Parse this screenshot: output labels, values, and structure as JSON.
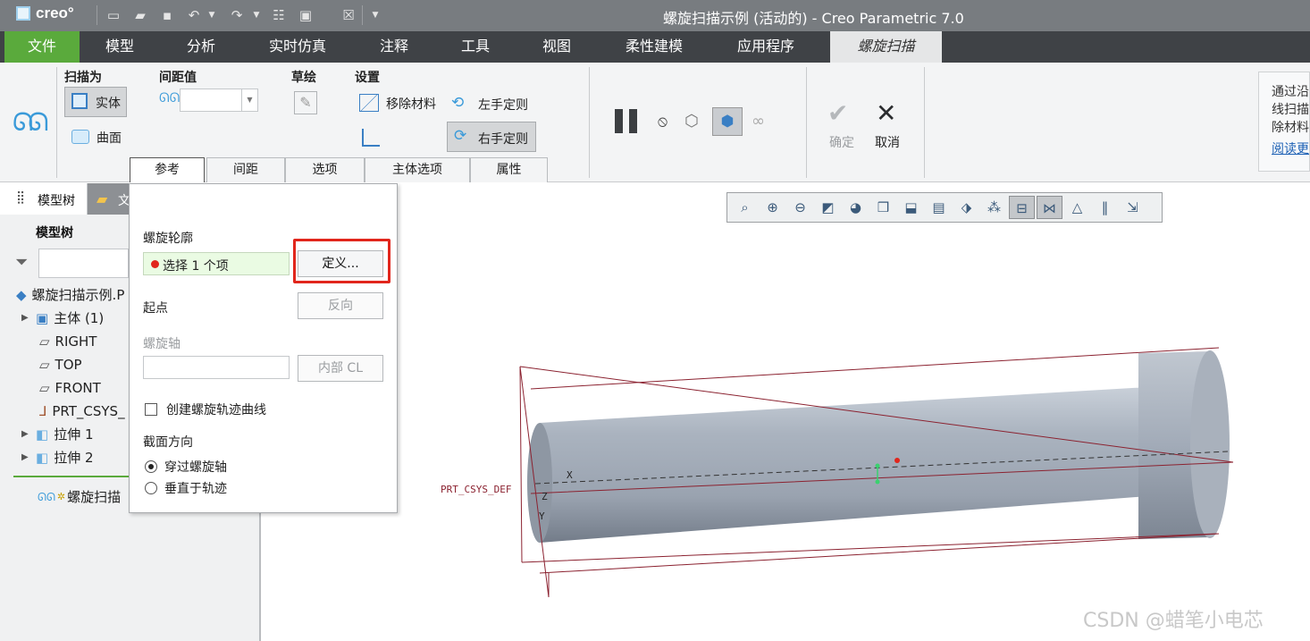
{
  "app": {
    "logo": "creo°",
    "window_title": "螺旋扫描示例 (活动的) - Creo Parametric 7.0"
  },
  "quick_access": [
    "new-icon",
    "open-icon",
    "save-icon",
    "undo-icon",
    "redo-icon",
    "regenerate-icon",
    "windows-icon",
    "close-window-icon",
    "customize-icon"
  ],
  "menu_tabs": [
    "文件",
    "模型",
    "分析",
    "实时仿真",
    "注释",
    "工具",
    "视图",
    "柔性建模",
    "应用程序",
    "螺旋扫描"
  ],
  "ribbon": {
    "sweep_as": {
      "title": "扫描为",
      "solid": "实体",
      "surface": "曲面"
    },
    "pitch": {
      "title": "间距值",
      "value": ""
    },
    "sketch": {
      "title": "草绘"
    },
    "settings": {
      "title": "设置",
      "remove_material": "移除材料",
      "left_hand": "左手定则",
      "right_hand": "右手定则"
    },
    "ok": "确定",
    "cancel": "取消",
    "help_lines": [
      "通过沿",
      "线扫描",
      "除材料"
    ],
    "help_link": "阅读更"
  },
  "sub_tabs": [
    "参考",
    "间距",
    "选项",
    "主体选项",
    "属性"
  ],
  "model_tree": {
    "tab_label": "模型树",
    "tab2_label": "文",
    "header": "模型树",
    "items": [
      {
        "label": "螺旋扫描示例.P"
      },
      {
        "label": "主体 (1)"
      },
      {
        "label": "RIGHT"
      },
      {
        "label": "TOP"
      },
      {
        "label": "FRONT"
      },
      {
        "label": "PRT_CSYS_"
      },
      {
        "label": "拉伸 1"
      },
      {
        "label": "拉伸 2"
      },
      {
        "label": "螺旋扫描"
      }
    ]
  },
  "references_panel": {
    "profile_label": "螺旋轮廓",
    "profile_value": "选择 1 个项",
    "define_button": "定义...",
    "start_label": "起点",
    "reverse_button": "反向",
    "axis_label": "螺旋轴",
    "internal_cl_button": "内部 CL",
    "create_curve_label": "创建螺旋轨迹曲线",
    "section_orientation_label": "截面方向",
    "option_through_axis": "穿过螺旋轴",
    "option_normal_to_trajectory": "垂直于轨迹"
  },
  "viewport": {
    "csys_label": "PRT_CSYS_DEF",
    "axis_x": "X",
    "axis_y": "Y",
    "axis_z": "Z"
  },
  "watermark": "CSDN @蜡笔小电芯"
}
